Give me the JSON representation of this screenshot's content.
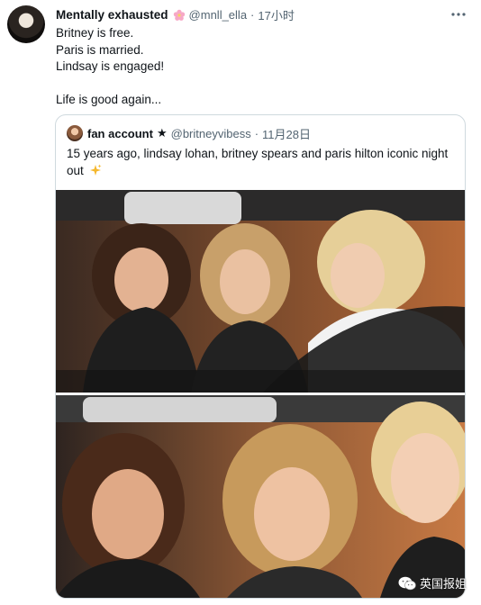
{
  "tweet": {
    "author_name": "Mentally exhausted",
    "author_handle": "@mnll_ella",
    "separator": "·",
    "time": "17小时",
    "icons": {
      "name_emoji": "cherry-blossom-icon",
      "more": "more-dots-icon"
    },
    "lines": [
      "Britney is free.",
      "Paris is married.",
      "Lindsay is engaged!",
      "",
      "Life is good again..."
    ]
  },
  "quote": {
    "author_name": "fan account",
    "star": "★",
    "author_handle": "@britneyvibess",
    "separator": "·",
    "date": "11月28日",
    "text": "15 years ago, lindsay lohan, britney spears and paris hilton iconic night out",
    "icons": {
      "text_emoji": "sparkles-icon"
    }
  },
  "watermark": {
    "text": "英国报姐",
    "icon": "wechat-icon"
  },
  "colors": {
    "muted": "#536471",
    "border": "#cfd9de",
    "text": "#0f1419"
  }
}
